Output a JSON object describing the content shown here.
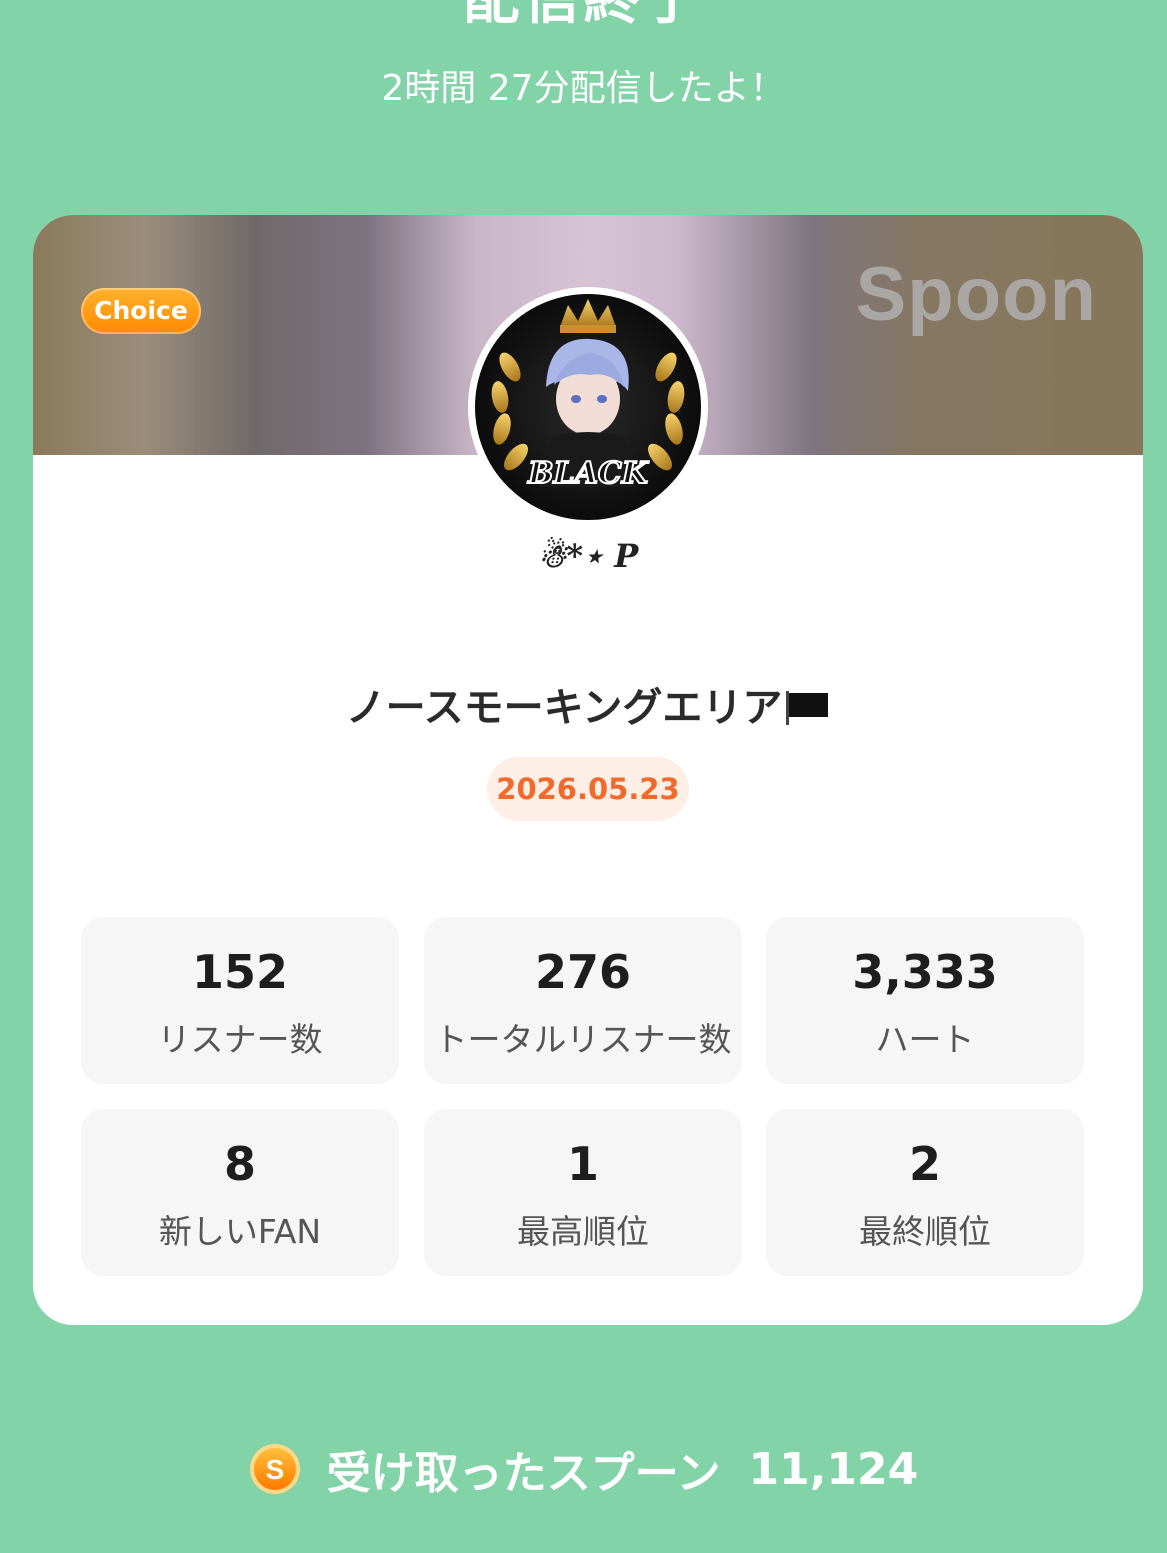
{
  "header": {
    "title": "配信終了",
    "subtitle": "2時間 27分配信したよ！"
  },
  "card": {
    "badge": "Choice",
    "logo": "Spoon",
    "avatar_text": "BLACK",
    "username": "☃*⋆ P",
    "broadcast_title": "ノースモーキングエリア",
    "title_icon": "black-flag-icon",
    "date": "2026.05.23",
    "stats": [
      {
        "value": "152",
        "label": "リスナー数"
      },
      {
        "value": "276",
        "label": "トータルリスナー数"
      },
      {
        "value": "3,333",
        "label": "ハート"
      },
      {
        "value": "8",
        "label": "新しいFAN"
      },
      {
        "value": "1",
        "label": "最高順位"
      },
      {
        "value": "2",
        "label": "最終順位"
      }
    ]
  },
  "footer": {
    "icon": "spoon-coin-icon",
    "coin_letter": "S",
    "label": "受け取ったスプーン",
    "value": "11,124"
  },
  "colors": {
    "background": "#82d3a7",
    "date_text": "#f26a2b",
    "badge": "#ff9a10"
  }
}
